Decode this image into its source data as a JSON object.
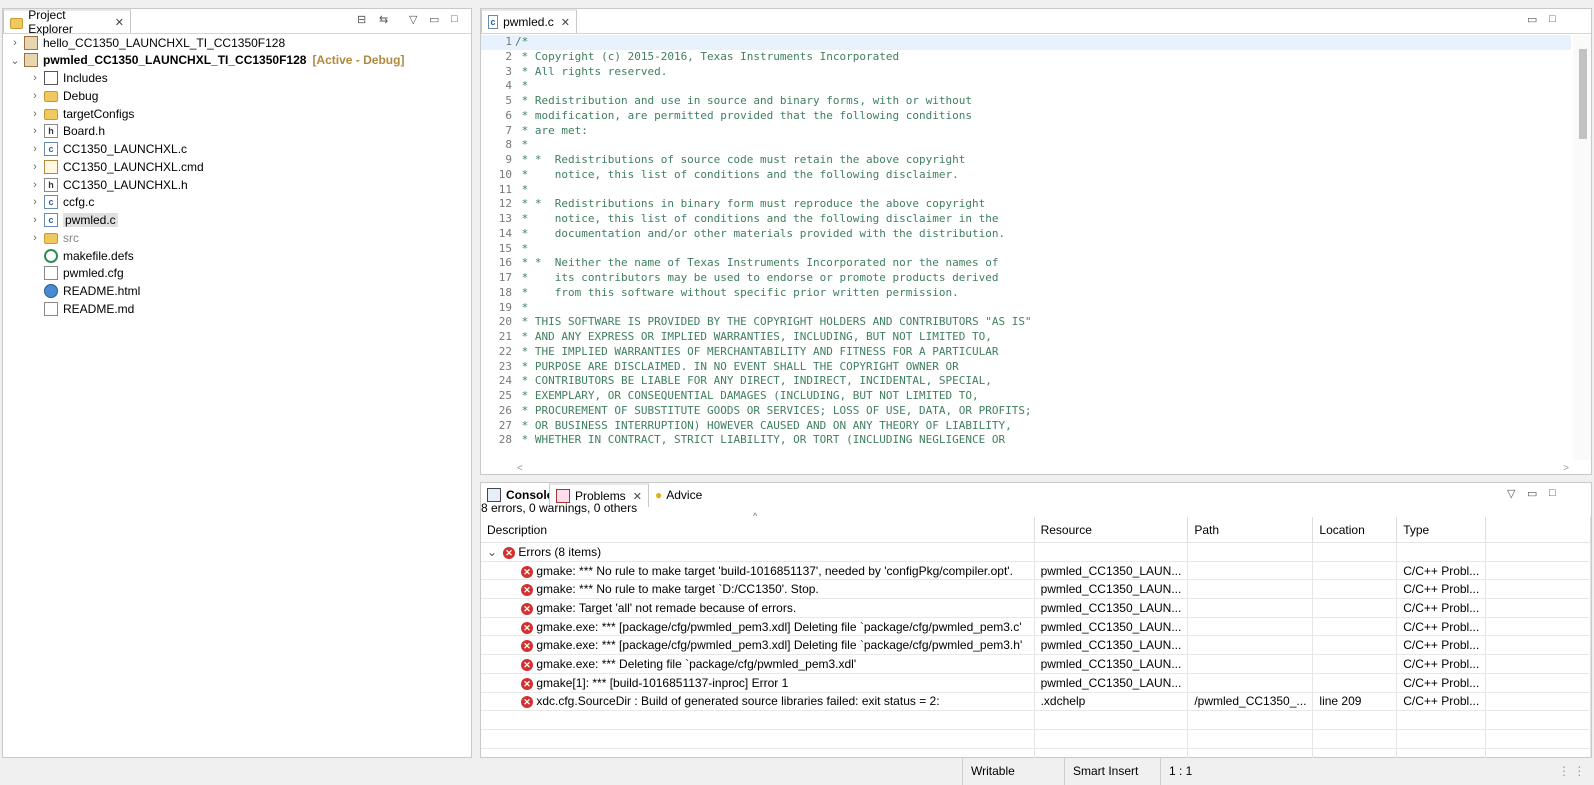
{
  "explorer": {
    "title": "Project Explorer",
    "projects": [
      {
        "name": "hello_CC1350_LAUNCHXL_TI_CC1350F128",
        "expanded": false,
        "badge": ""
      },
      {
        "name": "pwmled_CC1350_LAUNCHXL_TI_CC1350F128",
        "expanded": true,
        "badge": "[Active - Debug]"
      }
    ],
    "children": [
      {
        "label": "Includes",
        "icon": "includes-icon"
      },
      {
        "label": "Debug",
        "icon": "folder-icon"
      },
      {
        "label": "targetConfigs",
        "icon": "folder-icon"
      },
      {
        "label": "Board.h",
        "icon": "header-file-icon"
      },
      {
        "label": "CC1350_LAUNCHXL.c",
        "icon": "c-file-icon"
      },
      {
        "label": "CC1350_LAUNCHXL.cmd",
        "icon": "cmd-file-icon"
      },
      {
        "label": "CC1350_LAUNCHXL.h",
        "icon": "header-file-icon"
      },
      {
        "label": "ccfg.c",
        "icon": "c-file-icon"
      },
      {
        "label": "pwmled.c",
        "icon": "c-file-icon"
      },
      {
        "label": "src",
        "icon": "folder-icon"
      },
      {
        "label": "makefile.defs",
        "icon": "gear-file-icon"
      },
      {
        "label": "pwmled.cfg",
        "icon": "file-icon"
      },
      {
        "label": "README.html",
        "icon": "globe-icon"
      },
      {
        "label": "README.md",
        "icon": "file-icon"
      }
    ]
  },
  "editor": {
    "tab": "pwmled.c",
    "lines": [
      "/*",
      " * Copyright (c) 2015-2016, Texas Instruments Incorporated",
      " * All rights reserved.",
      " *",
      " * Redistribution and use in source and binary forms, with or without",
      " * modification, are permitted provided that the following conditions",
      " * are met:",
      " *",
      " * *  Redistributions of source code must retain the above copyright",
      " *    notice, this list of conditions and the following disclaimer.",
      " *",
      " * *  Redistributions in binary form must reproduce the above copyright",
      " *    notice, this list of conditions and the following disclaimer in the",
      " *    documentation and/or other materials provided with the distribution.",
      " *",
      " * *  Neither the name of Texas Instruments Incorporated nor the names of",
      " *    its contributors may be used to endorse or promote products derived",
      " *    from this software without specific prior written permission.",
      " *",
      " * THIS SOFTWARE IS PROVIDED BY THE COPYRIGHT HOLDERS AND CONTRIBUTORS \"AS IS\"",
      " * AND ANY EXPRESS OR IMPLIED WARRANTIES, INCLUDING, BUT NOT LIMITED TO,",
      " * THE IMPLIED WARRANTIES OF MERCHANTABILITY AND FITNESS FOR A PARTICULAR",
      " * PURPOSE ARE DISCLAIMED. IN NO EVENT SHALL THE COPYRIGHT OWNER OR",
      " * CONTRIBUTORS BE LIABLE FOR ANY DIRECT, INDIRECT, INCIDENTAL, SPECIAL,",
      " * EXEMPLARY, OR CONSEQUENTIAL DAMAGES (INCLUDING, BUT NOT LIMITED TO,",
      " * PROCUREMENT OF SUBSTITUTE GOODS OR SERVICES; LOSS OF USE, DATA, OR PROFITS;",
      " * OR BUSINESS INTERRUPTION) HOWEVER CAUSED AND ON ANY THEORY OF LIABILITY,",
      " * WHETHER IN CONTRACT, STRICT LIABILITY, OR TORT (INCLUDING NEGLIGENCE OR"
    ]
  },
  "bottom": {
    "tabs": [
      "Console",
      "Problems",
      "Advice"
    ],
    "summary": "8 errors, 0 warnings, 0 others",
    "columns": [
      "Description",
      "Resource",
      "Path",
      "Location",
      "Type"
    ],
    "group": "Errors (8 items)",
    "rows": [
      {
        "desc": "gmake: *** No rule to make target 'build-1016851137', needed by 'configPkg/compiler.opt'.",
        "resource": "pwmled_CC1350_LAUN...",
        "path": "",
        "location": "",
        "type": "C/C++ Probl..."
      },
      {
        "desc": "gmake: *** No rule to make target `D:/CC1350'.  Stop.",
        "resource": "pwmled_CC1350_LAUN...",
        "path": "",
        "location": "",
        "type": "C/C++ Probl..."
      },
      {
        "desc": "gmake: Target 'all' not remade because of errors.",
        "resource": "pwmled_CC1350_LAUN...",
        "path": "",
        "location": "",
        "type": "C/C++ Probl..."
      },
      {
        "desc": "gmake.exe: *** [package/cfg/pwmled_pem3.xdl] Deleting file `package/cfg/pwmled_pem3.c'",
        "resource": "pwmled_CC1350_LAUN...",
        "path": "",
        "location": "",
        "type": "C/C++ Probl..."
      },
      {
        "desc": "gmake.exe: *** [package/cfg/pwmled_pem3.xdl] Deleting file `package/cfg/pwmled_pem3.h'",
        "resource": "pwmled_CC1350_LAUN...",
        "path": "",
        "location": "",
        "type": "C/C++ Probl..."
      },
      {
        "desc": "gmake.exe: *** Deleting file `package/cfg/pwmled_pem3.xdl'",
        "resource": "pwmled_CC1350_LAUN...",
        "path": "",
        "location": "",
        "type": "C/C++ Probl..."
      },
      {
        "desc": "gmake[1]: *** [build-1016851137-inproc] Error 1",
        "resource": "pwmled_CC1350_LAUN...",
        "path": "",
        "location": "",
        "type": "C/C++ Probl..."
      },
      {
        "desc": "xdc.cfg.SourceDir : Build of generated source libraries failed: exit status = 2:",
        "resource": ".xdchelp",
        "path": "/pwmled_CC1350_...",
        "location": "line 209",
        "type": "C/C++ Probl..."
      }
    ]
  },
  "status": {
    "writable": "Writable",
    "insert": "Smart Insert",
    "position": "1 : 1"
  },
  "colors": {
    "comment": "#3f7f5f",
    "badge": "#b08a3e",
    "error": "#d43030"
  }
}
